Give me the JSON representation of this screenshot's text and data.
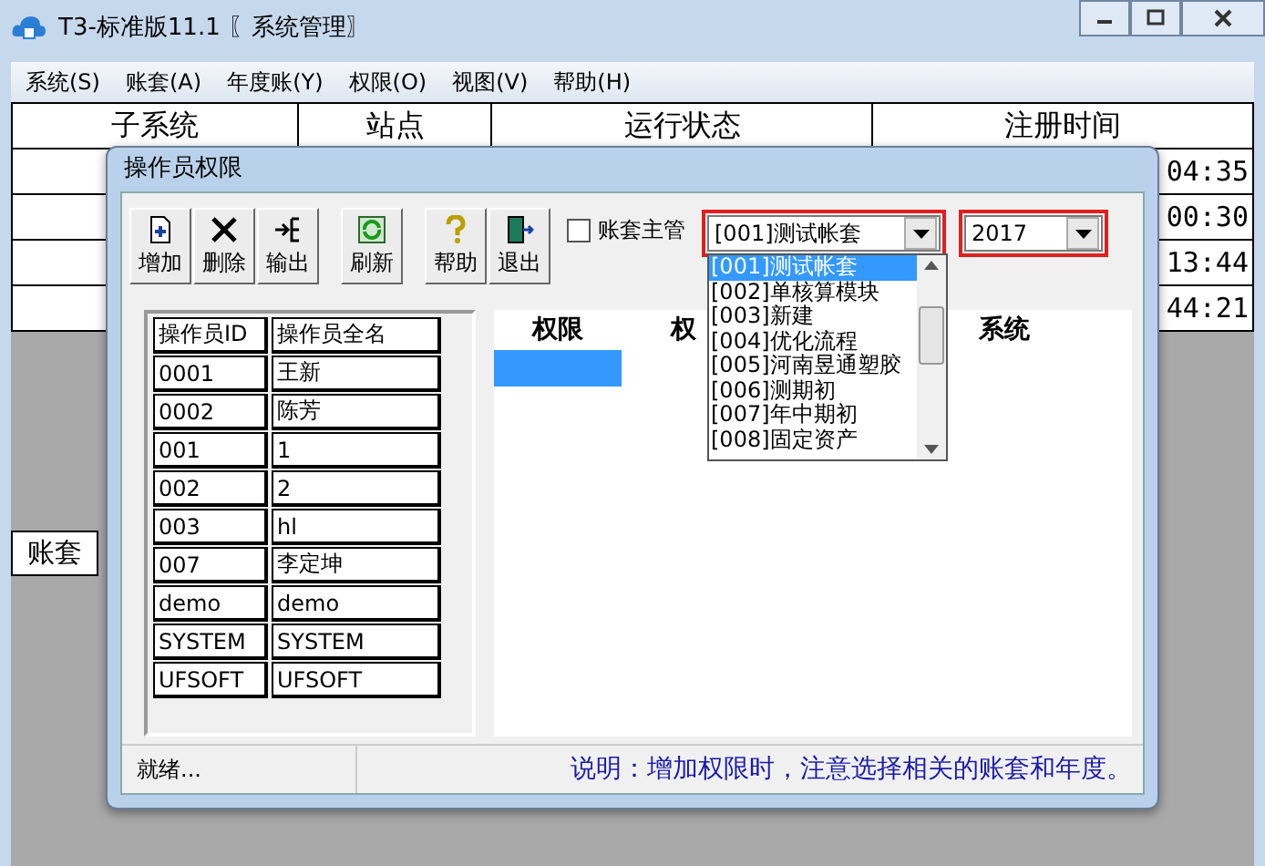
{
  "window": {
    "title": "T3-标准版11.1 〖系统管理〗"
  },
  "menu": [
    "系统(S)",
    "账套(A)",
    "年度账(Y)",
    "权限(O)",
    "视图(V)",
    "帮助(H)"
  ],
  "background_table": {
    "columns": [
      "子系统",
      "站点",
      "运行状态",
      "注册时间"
    ],
    "rows": [
      {
        "column_4": "04:35"
      },
      {
        "column_4": "00:30"
      },
      {
        "column_4": "13:44"
      },
      {
        "column_4": "44:21"
      }
    ]
  },
  "side_tab": {
    "label": "账套"
  },
  "dialog": {
    "title": "操作员权限",
    "toolbar": [
      {
        "label": "增加",
        "kind": "add",
        "group_start": false
      },
      {
        "label": "删除",
        "kind": "delete",
        "group_start": false
      },
      {
        "label": "输出",
        "kind": "export",
        "group_start": false
      },
      {
        "label": "刷新",
        "kind": "refresh",
        "group_start": true
      },
      {
        "label": "帮助",
        "kind": "help",
        "group_start": true
      },
      {
        "label": "退出",
        "kind": "exit",
        "group_start": false
      }
    ],
    "account_manager": {
      "label": "账套主管",
      "checked": false
    },
    "account_select": {
      "value": "[001]测试帐套",
      "highlighted": true,
      "expanded": true,
      "options": [
        {
          "label": "[001]测试帐套",
          "selected": true
        },
        {
          "label": "[002]单核算模块",
          "selected": false
        },
        {
          "label": "[003]新建",
          "selected": false
        },
        {
          "label": "[004]优化流程",
          "selected": false
        },
        {
          "label": "[005]河南昱通塑胶",
          "selected": false
        },
        {
          "label": "[006]测期初",
          "selected": false
        },
        {
          "label": "[007]年中期初",
          "selected": false
        },
        {
          "label": "[008]固定资产",
          "selected": false
        }
      ]
    },
    "year_select": {
      "value": "2017",
      "highlighted": true
    },
    "operators": {
      "columns": [
        "操作员ID",
        "操作员全名"
      ],
      "rows": [
        [
          "0001",
          "王新"
        ],
        [
          "0002",
          "陈芳"
        ],
        [
          "001",
          "1"
        ],
        [
          "002",
          "2"
        ],
        [
          "003",
          "hl"
        ],
        [
          "007",
          "李定坤"
        ],
        [
          "demo",
          "demo"
        ],
        [
          "SYSTEM",
          "SYSTEM"
        ],
        [
          "UFSOFT",
          "UFSOFT"
        ]
      ]
    },
    "permissions": {
      "columns": [
        "权限",
        "权",
        "系统"
      ]
    },
    "status": "就绪...",
    "note": "说明：增加权限时，注意选择相关的账套和年度。"
  }
}
